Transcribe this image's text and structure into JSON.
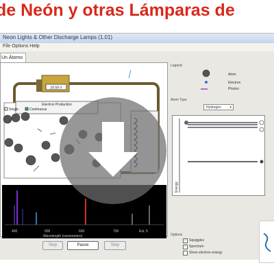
{
  "banner": {
    "title": "de Neón y otras Lámparas de"
  },
  "window": {
    "title": "Neon Lights & Other Discharge Lamps (1.01)",
    "menu": "File  Options  Help"
  },
  "tab": {
    "label": "Un Átomo"
  },
  "sim": {
    "battery_value": "29.59 V",
    "electron_production_label": "Electron Production",
    "single_label": "Single",
    "continuous_label": "Continuous",
    "spectrometer_ticks": [
      "400",
      "500",
      "600",
      "700",
      "Ext. 5"
    ],
    "spectrometer_title": "Wavelength (nanometers)"
  },
  "controls": {
    "step_label": "Step",
    "pause_label": "Pause",
    "play_label": "Step"
  },
  "right": {
    "legend_label": "Legend",
    "legend_items": [
      "Atom",
      "Electron",
      "Photon"
    ],
    "atom_type_label": "Atom Type",
    "atom_type_value": "Hydrogen",
    "energy_axis_label": "Energy",
    "options_label": "Options",
    "options": [
      {
        "label": "Squiggles",
        "checked": true
      },
      {
        "label": "Spectrum",
        "checked": true
      },
      {
        "label": "Show electron energy",
        "checked": false
      }
    ]
  },
  "colors": {
    "banner_text": "#d9281c",
    "spectrum_bg": "#000000",
    "overlay": "#707070"
  }
}
